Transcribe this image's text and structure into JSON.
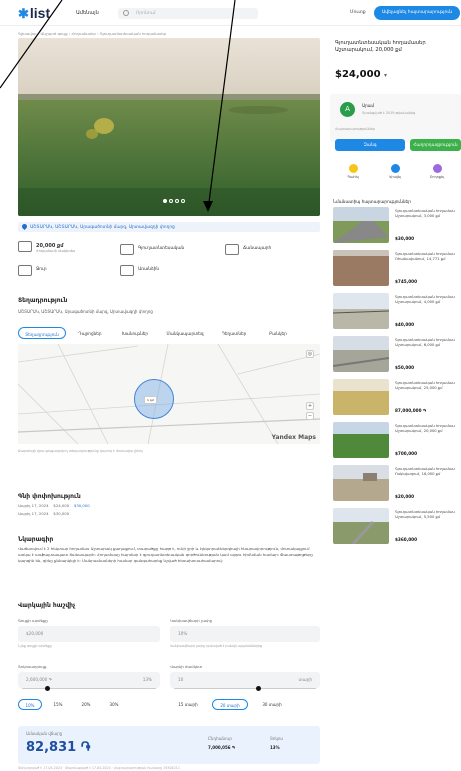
{
  "header": {
    "logo_text": "list",
    "category_label": "Ամենայն",
    "search_placeholder": "Որոնում",
    "signin_label": "Մուտք",
    "post_ad_label": "Ավելացնել հայտարարություն"
  },
  "breadcrumb": "Գլխավոր › Անշարժ գույք › Հողամասեր › Գյուղատնտեսական հողամասեր",
  "listing": {
    "address": "ԱՇՏԱՐԱԿ, ԱՇՏԱՐԱԿ, Արագածոտնի մարզ, Արտավազդի փողոց",
    "attributes": [
      {
        "value": "20,000 քմ",
        "sub": "Հողամասի մակերես",
        "icon": "area-icon"
      },
      {
        "label": "Գյուղատնտեսական",
        "icon": "land-type-icon"
      },
      {
        "label": "Ճանապարհ",
        "icon": "road-icon"
      },
      {
        "label": "Ջուր",
        "icon": "water-icon"
      },
      {
        "label": "Առանձին",
        "icon": "fence-icon"
      }
    ],
    "location_title": "Տեղադրություն",
    "location_address": "ԱՇՏԱՐԱԿ, ԱՇՏԱՐԱԿ, Արագածոտնի մարզ, Արտավազդի փողոց",
    "map_tabs": [
      "Տեղադրություն",
      "Դպրոցներ",
      "Խանութներ",
      "Մանկապարտեզ",
      "Դեղատներ",
      "Բանկեր"
    ],
    "map_label": "1 կմ",
    "map_brand": "Yandex Maps",
    "map_note": "Քարտեզի վրա ցուցադրվող տեղադրությունը կարող է մոտավոր լինել",
    "price_history_title": "Գնի փոփոխություն",
    "price_history": [
      {
        "date": "Ապրիլ 17, 2024",
        "old": "$24,000",
        "new": "$30,000"
      },
      {
        "date": "Ապրիլ 17, 2024",
        "old": "$30,000",
        "new": ""
      }
    ],
    "description_title": "Նկարագիր",
    "description": "Վաճառվում է 2 հեկտար հողամաս Աշտարակ քաղաքում, տարածքը հարթ է, ունի ջրի և էլեկտրաէներգիայի հնարավորություն, մոտակայքում առկա է ասֆալտապատ ճանապարհ։ Հողամասը հարմար է գյուղատնտեսական գործունեության կամ այգու հիմնման համար։ Փաստաթղթերը կարգին են, գինը քննարկելի է։ Մանրամասների համար զանգահարեք նշված հեռախոսահամարով։",
    "calc_title": "Վարկային հաշվիչ",
    "calc": {
      "price_label": "Գույքի արժեքը",
      "price_value": "$20,000",
      "down_label": "Կանխավճարի չափը",
      "down_value": "10%",
      "down_note": "Կանխավճարի չափը կախված է բանկի պայմաններից",
      "price_note": "Նշեք գույքի արժեքը",
      "rate_label": "Տոկոսադրույք",
      "rate_value": "13%",
      "rate_min": "2,600,000 ֏",
      "term_label": "Վարկի ժամկետ",
      "term_value": "10",
      "term_unit": "տարի",
      "rate_chips": [
        "10%",
        "15%",
        "20%",
        "30%"
      ],
      "term_chips": [
        "15 տարի",
        "20 տարի",
        "30 տարի"
      ],
      "monthly_label": "Ամսական վճարը",
      "monthly_value": "82,831 ֏",
      "total_label": "Ընդհանուր",
      "total_value": "7,000,056 ֏",
      "rate_out_label": "Տոկոս",
      "rate_out_value": "13%"
    },
    "footer": "Տեղադրված է 17.04.2024 · Թարմացված է 17.04.2024 · Հայտարարության համարը 19304211"
  },
  "sidebar": {
    "title": "Գյուղատնտեսական հողամասեր Աշտարակում, 20,000 քմ",
    "price": "$24,000",
    "seller_initial": "A",
    "seller_name": "Արամ",
    "seller_since": "Գրանցված է 2019 թվականից",
    "seller_ads": "Հայտարարություններ",
    "call_label": "Զանգ",
    "message_label": "Հաղորդագրություն",
    "actions": [
      "Պահել",
      "Կիսվել",
      "Բողոքել"
    ],
    "similar_title": "Նմանատիպ հայտարարություններ",
    "similar": [
      {
        "text": "Գյուղատնտեսական հողամաս Աշտարակում, 3,000 քմ",
        "price": "$30,000"
      },
      {
        "text": "Գյուղատնտեսական հողամաս Օհանավանում, 14,771 քմ",
        "price": "$745,000"
      },
      {
        "text": "Գյուղատնտեսական հողամաս Աշտարակում, 4,000 քմ",
        "price": "$40,000"
      },
      {
        "text": "Գյուղատնտեսական հողամաս Աշտարակում, 6,000 քմ",
        "price": "$50,000"
      },
      {
        "text": "Գյուղատնտեսական հողամաս Աշտարակում, 25,000 քմ",
        "price": "87,000,000 ֏"
      },
      {
        "text": "Գյուղատնտեսական հողամաս Աշտարակում, 20,000 քմ",
        "price": "$700,000"
      },
      {
        "text": "Գյուղատնտեսական հողամաս Ոսկեվազում, 16,000 քմ",
        "price": "$20,000"
      },
      {
        "text": "Գյուղատնտեսական հողամաս Աշտարակում, 5,500 քմ",
        "price": "$360,000"
      }
    ]
  }
}
